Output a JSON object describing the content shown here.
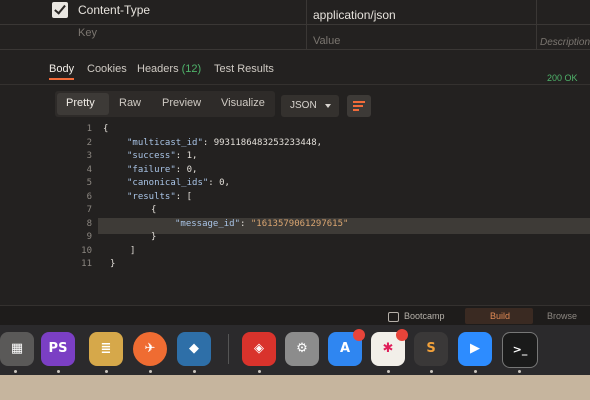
{
  "headers_table": {
    "row1": {
      "key": "Content-Type",
      "value": "application/json"
    },
    "row2": {
      "key_placeholder": "Key",
      "value_placeholder": "Value",
      "description_placeholder": "Description"
    }
  },
  "response_tabs": [
    {
      "label": "Body"
    },
    {
      "label": "Cookies"
    },
    {
      "label": "Headers",
      "count": "(12)"
    },
    {
      "label": "Test Results"
    }
  ],
  "status": "200 OK",
  "toolbar": {
    "views": [
      "Pretty",
      "Raw",
      "Preview",
      "Visualize"
    ],
    "format": "JSON"
  },
  "code": {
    "line_numbers": [
      "1",
      "2",
      "3",
      "4",
      "5",
      "6",
      "7",
      "8",
      "9",
      "10",
      "11"
    ],
    "multicast_key": "\"multicast_id\"",
    "multicast_val": "9931186483253233448",
    "success_key": "\"success\"",
    "success_val": "1",
    "failure_key": "\"failure\"",
    "failure_val": "0",
    "canonical_key": "\"canonical_ids\"",
    "canonical_val": "0",
    "results_key": "\"results\"",
    "message_key": "\"message_id\"",
    "message_val": "\"1613579061297615\""
  },
  "statusbar": {
    "bootcamp": "Bootcamp",
    "build": "Build",
    "browse": "Browse"
  },
  "dock": [
    {
      "name": "calculator",
      "color": "#5a5958",
      "glyph": "▦"
    },
    {
      "name": "phpstorm",
      "color": "#7b3fc4",
      "glyph": "PS"
    },
    {
      "name": "database",
      "color": "#d6a84a",
      "glyph": "≣"
    },
    {
      "name": "postman",
      "color": "#ef6c32",
      "glyph": "✈"
    },
    {
      "name": "mysql-workbench",
      "color": "#2e6fa8",
      "glyph": "◆"
    },
    {
      "name": "git",
      "color": "#d9332c",
      "glyph": "◈"
    },
    {
      "name": "settings",
      "color": "#8c8c8c",
      "glyph": "⚙"
    },
    {
      "name": "app-store",
      "color": "#2f86f1",
      "glyph": "A"
    },
    {
      "name": "slack",
      "color": "#f2efe9",
      "glyph": "✱"
    },
    {
      "name": "sublime",
      "color": "#3a3838",
      "glyph": "S"
    },
    {
      "name": "zoom",
      "color": "#2d8cff",
      "glyph": "▶"
    },
    {
      "name": "terminal",
      "color": "#1a1a1a",
      "glyph": ">_"
    }
  ]
}
